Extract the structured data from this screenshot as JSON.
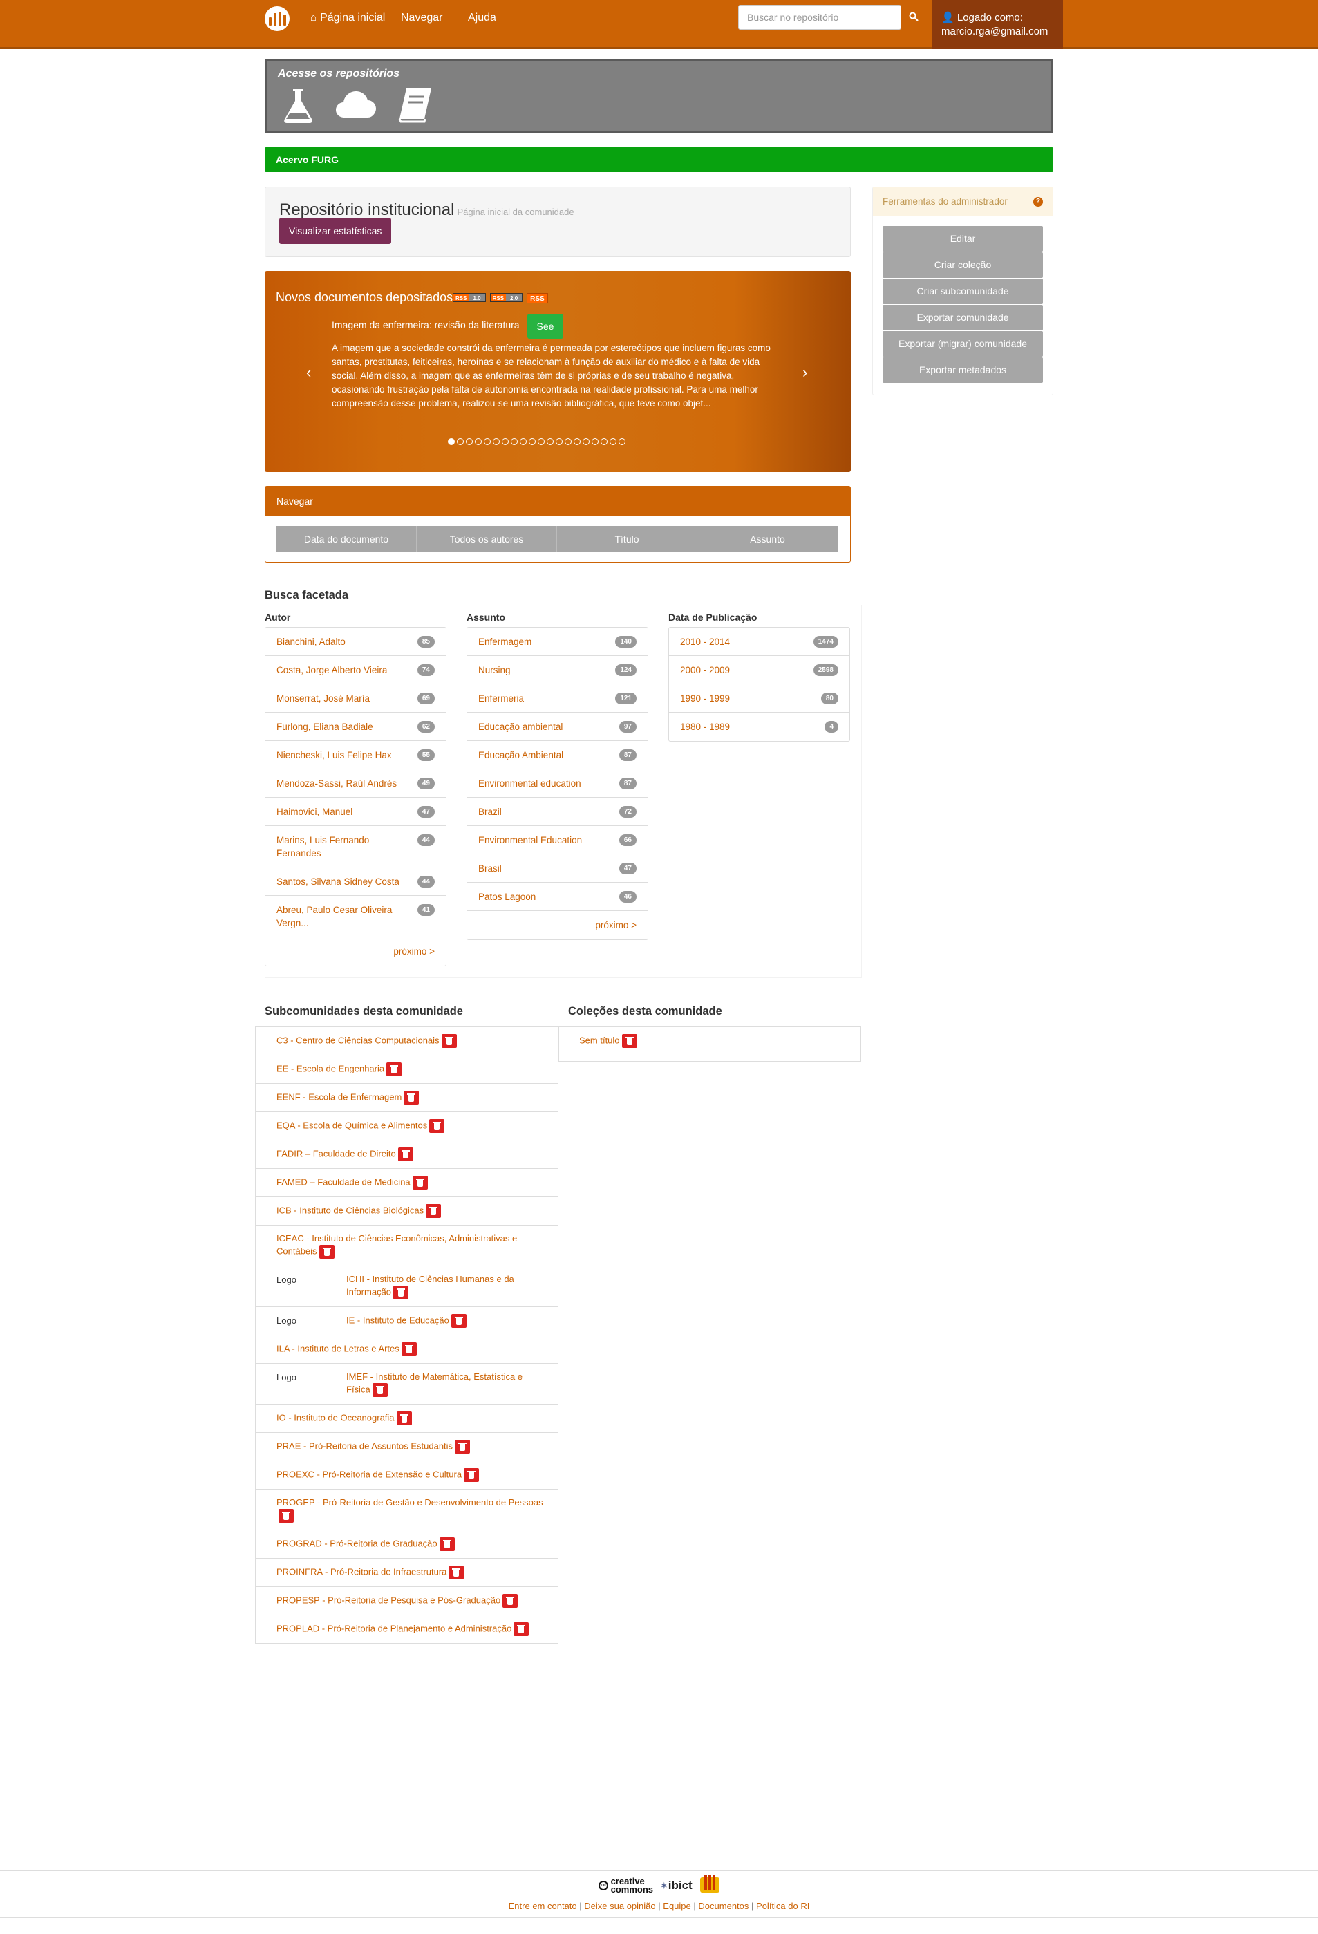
{
  "navbar": {
    "home_label": "Página inicial",
    "browse_label": "Navegar",
    "help_label": "Ajuda",
    "search_placeholder": "Buscar no repositório",
    "user_line1": "Logado como:",
    "user_email": "marcio.rga@gmail.com"
  },
  "repo_banner": {
    "title": "Acesse os repositórios"
  },
  "breadcrumb": {
    "label": "Acervo FURG"
  },
  "community": {
    "name": "Repositório institucional",
    "subtitle": "Página inicial da comunidade",
    "stats_button": "Visualizar estatísticas"
  },
  "carousel": {
    "heading": "Novos documentos depositados",
    "feed1": [
      "RSS",
      "1.0"
    ],
    "feed2": [
      "RSS",
      "2.0"
    ],
    "rss": "RSS",
    "item_title": "Imagem da enfermeira: revisão da literatura",
    "see_label": "See",
    "abstract": "A imagem que a sociedade constrói da enfermeira é permeada por estereótipos que incluem figuras como santas, prostitutas, feiticeiras, heroínas e se relacionam à função de auxiliar do médico e à falta de vida social. Além disso, a imagem que as enfermeiras têm de si próprias e de seu trabalho é negativa, ocasionando frustração pela falta de autonomia encontrada na realidade profissional. Para uma melhor compreensão desse problema, realizou-se uma revisão bibliográfica, que teve como objet...",
    "prev": "‹",
    "next": "›",
    "slide_count": 20,
    "active_slide": 1
  },
  "browse": {
    "title": "Navegar",
    "buttons": [
      "Data do documento",
      "Todos os autores",
      "Título",
      "Assunto"
    ]
  },
  "admin": {
    "title": "Ferramentas do administrador",
    "help": "?",
    "buttons": [
      "Editar",
      "Criar coleção",
      "Criar subcomunidade",
      "Exportar comunidade",
      "Exportar (migrar) comunidade",
      "Exportar metadados"
    ]
  },
  "facets": {
    "title": "Busca facetada",
    "author": {
      "label": "Autor",
      "items": [
        {
          "name": "Bianchini, Adalto",
          "count": "85"
        },
        {
          "name": "Costa, Jorge Alberto Vieira",
          "count": "74"
        },
        {
          "name": "Monserrat, José María",
          "count": "69"
        },
        {
          "name": "Furlong, Eliana Badiale",
          "count": "62"
        },
        {
          "name": "Niencheski, Luis Felipe Hax",
          "count": "55"
        },
        {
          "name": "Mendoza-Sassi, Raúl Andrés",
          "count": "49"
        },
        {
          "name": "Haimovici, Manuel",
          "count": "47"
        },
        {
          "name": "Marins, Luis Fernando Fernandes",
          "count": "44"
        },
        {
          "name": "Santos, Silvana Sidney Costa",
          "count": "44"
        },
        {
          "name": "Abreu, Paulo Cesar Oliveira Vergn...",
          "count": "41"
        }
      ],
      "next": "próximo >"
    },
    "subject": {
      "label": "Assunto",
      "items": [
        {
          "name": "Enfermagem",
          "count": "140"
        },
        {
          "name": "Nursing",
          "count": "124"
        },
        {
          "name": "Enfermeria",
          "count": "121"
        },
        {
          "name": "Educação ambiental",
          "count": "97"
        },
        {
          "name": "Educação Ambiental",
          "count": "87"
        },
        {
          "name": "Environmental education",
          "count": "87"
        },
        {
          "name": "Brazil",
          "count": "72"
        },
        {
          "name": "Environmental Education",
          "count": "66"
        },
        {
          "name": "Brasil",
          "count": "47"
        },
        {
          "name": "Patos Lagoon",
          "count": "46"
        }
      ],
      "next": "próximo >"
    },
    "date": {
      "label": "Data de Publicação",
      "items": [
        {
          "name": "2010 - 2014",
          "count": "1474"
        },
        {
          "name": "2000 - 2009",
          "count": "2598"
        },
        {
          "name": "1990 - 1999",
          "count": "80"
        },
        {
          "name": "1980 - 1989",
          "count": "4"
        }
      ]
    }
  },
  "subcommunities": {
    "title": "Subcomunidades desta comunidade",
    "logo_label": "Logo",
    "items": [
      {
        "name": "C3 - Centro de Ciências Computacionais",
        "logo": false
      },
      {
        "name": "EE - Escola de Engenharia",
        "logo": false
      },
      {
        "name": "EENF - Escola de Enfermagem",
        "logo": false
      },
      {
        "name": "EQA - Escola de Química e Alimentos",
        "logo": false
      },
      {
        "name": "FADIR – Faculdade de Direito",
        "logo": false
      },
      {
        "name": "FAMED – Faculdade de Medicina",
        "logo": false
      },
      {
        "name": "ICB - Instituto de Ciências Biológicas",
        "logo": false
      },
      {
        "name": "ICEAC - Instituto de Ciências Econômicas, Administrativas e Contábeis",
        "logo": false
      },
      {
        "name": "ICHI - Instituto de Ciências Humanas e da Informação",
        "logo": true
      },
      {
        "name": "IE - Instituto de Educação",
        "logo": true
      },
      {
        "name": "ILA - Instituto de Letras e Artes",
        "logo": false
      },
      {
        "name": "IMEF - Instituto de Matemática, Estatística e Física",
        "logo": true
      },
      {
        "name": "IO - Instituto de Oceanografia",
        "logo": false
      },
      {
        "name": "PRAE - Pró-Reitoria de Assuntos Estudantis",
        "logo": false
      },
      {
        "name": "PROEXC - Pró-Reitoria de Extensão e Cultura",
        "logo": false
      },
      {
        "name": "PROGEP - Pró-Reitoria de Gestão e Desenvolvimento de Pessoas",
        "logo": false
      },
      {
        "name": "PROGRAD - Pró-Reitoria de Graduação",
        "logo": false
      },
      {
        "name": "PROINFRA - Pró-Reitoria de Infraestrutura",
        "logo": false
      },
      {
        "name": "PROPESP - Pró-Reitoria de Pesquisa e Pós-Graduação",
        "logo": false
      },
      {
        "name": "PROPLAD - Pró-Reitoria de Planejamento e Administração",
        "logo": false
      }
    ]
  },
  "collections": {
    "title": "Coleções desta comunidade",
    "items": [
      {
        "name": "Sem título"
      }
    ]
  },
  "footer": {
    "cc_line1": "creative",
    "cc_line2": "commons",
    "ibict": "ibict",
    "links": [
      "Entre em contato",
      "Deixe sua opinião",
      "Equipe",
      "Documentos",
      "Política do RI"
    ],
    "separator": "|"
  }
}
